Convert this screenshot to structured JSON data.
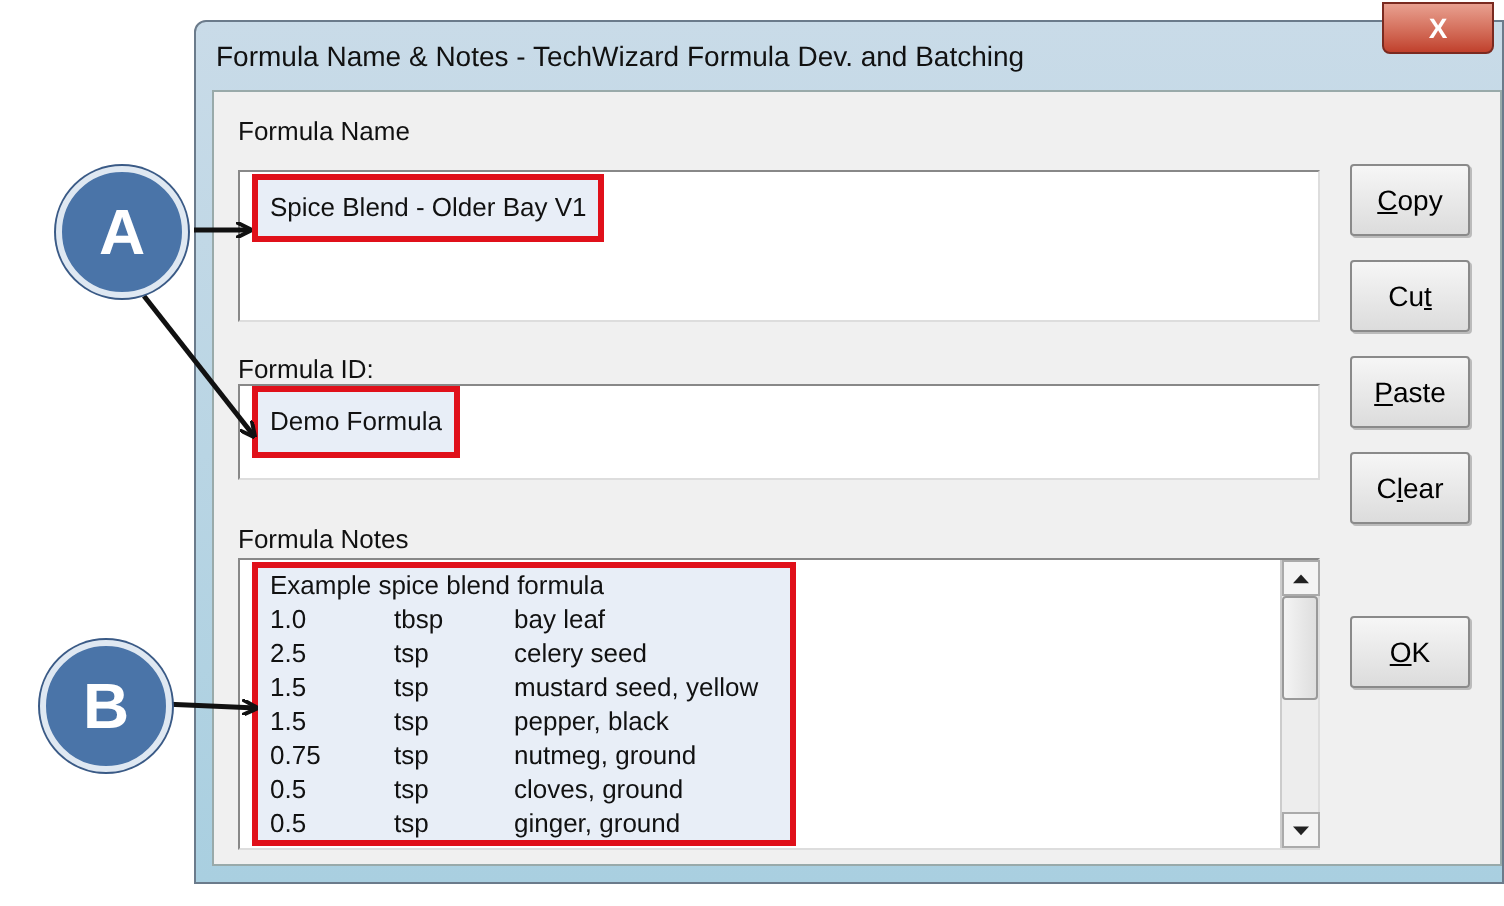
{
  "window": {
    "title": "Formula Name & Notes - TechWizard Formula Dev. and Batching",
    "close": "X"
  },
  "name_field": {
    "label": "Formula Name",
    "value": "Spice Blend - Older Bay V1"
  },
  "id_field": {
    "label": "Formula ID:",
    "value": "Demo Formula"
  },
  "notes": {
    "label": "Formula Notes",
    "heading": "Example spice blend formula",
    "rows": [
      {
        "qty": "1.0",
        "unit": "tbsp",
        "item": "bay leaf"
      },
      {
        "qty": "2.5",
        "unit": "tsp",
        "item": "celery seed"
      },
      {
        "qty": "1.5",
        "unit": "tsp",
        "item": "mustard seed, yellow"
      },
      {
        "qty": "1.5",
        "unit": "tsp",
        "item": "pepper, black"
      },
      {
        "qty": "0.75",
        "unit": "tsp",
        "item": "nutmeg, ground"
      },
      {
        "qty": "0.5",
        "unit": "tsp",
        "item": "cloves, ground"
      },
      {
        "qty": "0.5",
        "unit": "tsp",
        "item": "ginger, ground"
      }
    ]
  },
  "side_buttons": [
    {
      "key": "C",
      "after": "opy"
    },
    {
      "before": "Cu",
      "key": "t"
    },
    {
      "key": "P",
      "after": "aste"
    },
    {
      "before": "C",
      "key": "l",
      "after": "ear"
    }
  ],
  "ok_button": {
    "key": "O",
    "after": "K"
  },
  "callouts": [
    {
      "letter": "A"
    },
    {
      "letter": "B"
    }
  ]
}
